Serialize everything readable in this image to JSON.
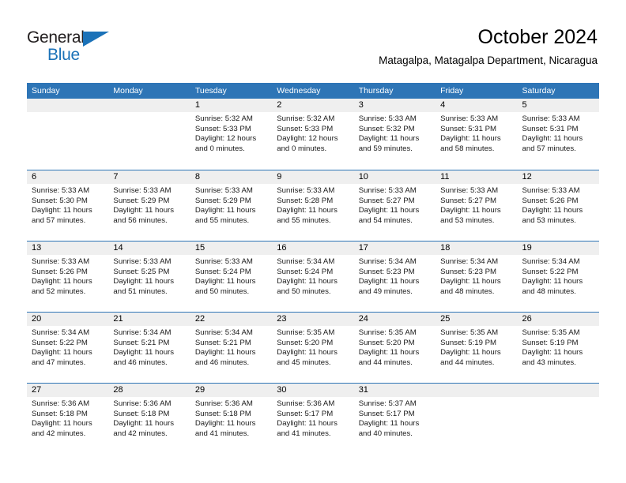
{
  "brand": {
    "name_top": "General",
    "name_bottom": "Blue",
    "accent_color": "#1b72b8"
  },
  "header": {
    "title": "October 2024",
    "subtitle": "Matagalpa, Matagalpa Department, Nicaragua"
  },
  "theme": {
    "header_blue": "#2e75b6",
    "day_band_gray": "#efefef",
    "text_color": "#000000"
  },
  "weekdays": [
    "Sunday",
    "Monday",
    "Tuesday",
    "Wednesday",
    "Thursday",
    "Friday",
    "Saturday"
  ],
  "weeks": [
    [
      {
        "day": "",
        "lines": []
      },
      {
        "day": "",
        "lines": []
      },
      {
        "day": "1",
        "lines": [
          "Sunrise: 5:32 AM",
          "Sunset: 5:33 PM",
          "Daylight: 12 hours",
          "and 0 minutes."
        ]
      },
      {
        "day": "2",
        "lines": [
          "Sunrise: 5:32 AM",
          "Sunset: 5:33 PM",
          "Daylight: 12 hours",
          "and 0 minutes."
        ]
      },
      {
        "day": "3",
        "lines": [
          "Sunrise: 5:33 AM",
          "Sunset: 5:32 PM",
          "Daylight: 11 hours",
          "and 59 minutes."
        ]
      },
      {
        "day": "4",
        "lines": [
          "Sunrise: 5:33 AM",
          "Sunset: 5:31 PM",
          "Daylight: 11 hours",
          "and 58 minutes."
        ]
      },
      {
        "day": "5",
        "lines": [
          "Sunrise: 5:33 AM",
          "Sunset: 5:31 PM",
          "Daylight: 11 hours",
          "and 57 minutes."
        ]
      }
    ],
    [
      {
        "day": "6",
        "lines": [
          "Sunrise: 5:33 AM",
          "Sunset: 5:30 PM",
          "Daylight: 11 hours",
          "and 57 minutes."
        ]
      },
      {
        "day": "7",
        "lines": [
          "Sunrise: 5:33 AM",
          "Sunset: 5:29 PM",
          "Daylight: 11 hours",
          "and 56 minutes."
        ]
      },
      {
        "day": "8",
        "lines": [
          "Sunrise: 5:33 AM",
          "Sunset: 5:29 PM",
          "Daylight: 11 hours",
          "and 55 minutes."
        ]
      },
      {
        "day": "9",
        "lines": [
          "Sunrise: 5:33 AM",
          "Sunset: 5:28 PM",
          "Daylight: 11 hours",
          "and 55 minutes."
        ]
      },
      {
        "day": "10",
        "lines": [
          "Sunrise: 5:33 AM",
          "Sunset: 5:27 PM",
          "Daylight: 11 hours",
          "and 54 minutes."
        ]
      },
      {
        "day": "11",
        "lines": [
          "Sunrise: 5:33 AM",
          "Sunset: 5:27 PM",
          "Daylight: 11 hours",
          "and 53 minutes."
        ]
      },
      {
        "day": "12",
        "lines": [
          "Sunrise: 5:33 AM",
          "Sunset: 5:26 PM",
          "Daylight: 11 hours",
          "and 53 minutes."
        ]
      }
    ],
    [
      {
        "day": "13",
        "lines": [
          "Sunrise: 5:33 AM",
          "Sunset: 5:26 PM",
          "Daylight: 11 hours",
          "and 52 minutes."
        ]
      },
      {
        "day": "14",
        "lines": [
          "Sunrise: 5:33 AM",
          "Sunset: 5:25 PM",
          "Daylight: 11 hours",
          "and 51 minutes."
        ]
      },
      {
        "day": "15",
        "lines": [
          "Sunrise: 5:33 AM",
          "Sunset: 5:24 PM",
          "Daylight: 11 hours",
          "and 50 minutes."
        ]
      },
      {
        "day": "16",
        "lines": [
          "Sunrise: 5:34 AM",
          "Sunset: 5:24 PM",
          "Daylight: 11 hours",
          "and 50 minutes."
        ]
      },
      {
        "day": "17",
        "lines": [
          "Sunrise: 5:34 AM",
          "Sunset: 5:23 PM",
          "Daylight: 11 hours",
          "and 49 minutes."
        ]
      },
      {
        "day": "18",
        "lines": [
          "Sunrise: 5:34 AM",
          "Sunset: 5:23 PM",
          "Daylight: 11 hours",
          "and 48 minutes."
        ]
      },
      {
        "day": "19",
        "lines": [
          "Sunrise: 5:34 AM",
          "Sunset: 5:22 PM",
          "Daylight: 11 hours",
          "and 48 minutes."
        ]
      }
    ],
    [
      {
        "day": "20",
        "lines": [
          "Sunrise: 5:34 AM",
          "Sunset: 5:22 PM",
          "Daylight: 11 hours",
          "and 47 minutes."
        ]
      },
      {
        "day": "21",
        "lines": [
          "Sunrise: 5:34 AM",
          "Sunset: 5:21 PM",
          "Daylight: 11 hours",
          "and 46 minutes."
        ]
      },
      {
        "day": "22",
        "lines": [
          "Sunrise: 5:34 AM",
          "Sunset: 5:21 PM",
          "Daylight: 11 hours",
          "and 46 minutes."
        ]
      },
      {
        "day": "23",
        "lines": [
          "Sunrise: 5:35 AM",
          "Sunset: 5:20 PM",
          "Daylight: 11 hours",
          "and 45 minutes."
        ]
      },
      {
        "day": "24",
        "lines": [
          "Sunrise: 5:35 AM",
          "Sunset: 5:20 PM",
          "Daylight: 11 hours",
          "and 44 minutes."
        ]
      },
      {
        "day": "25",
        "lines": [
          "Sunrise: 5:35 AM",
          "Sunset: 5:19 PM",
          "Daylight: 11 hours",
          "and 44 minutes."
        ]
      },
      {
        "day": "26",
        "lines": [
          "Sunrise: 5:35 AM",
          "Sunset: 5:19 PM",
          "Daylight: 11 hours",
          "and 43 minutes."
        ]
      }
    ],
    [
      {
        "day": "27",
        "lines": [
          "Sunrise: 5:36 AM",
          "Sunset: 5:18 PM",
          "Daylight: 11 hours",
          "and 42 minutes."
        ]
      },
      {
        "day": "28",
        "lines": [
          "Sunrise: 5:36 AM",
          "Sunset: 5:18 PM",
          "Daylight: 11 hours",
          "and 42 minutes."
        ]
      },
      {
        "day": "29",
        "lines": [
          "Sunrise: 5:36 AM",
          "Sunset: 5:18 PM",
          "Daylight: 11 hours",
          "and 41 minutes."
        ]
      },
      {
        "day": "30",
        "lines": [
          "Sunrise: 5:36 AM",
          "Sunset: 5:17 PM",
          "Daylight: 11 hours",
          "and 41 minutes."
        ]
      },
      {
        "day": "31",
        "lines": [
          "Sunrise: 5:37 AM",
          "Sunset: 5:17 PM",
          "Daylight: 11 hours",
          "and 40 minutes."
        ]
      },
      {
        "day": "",
        "lines": []
      },
      {
        "day": "",
        "lines": []
      }
    ]
  ]
}
